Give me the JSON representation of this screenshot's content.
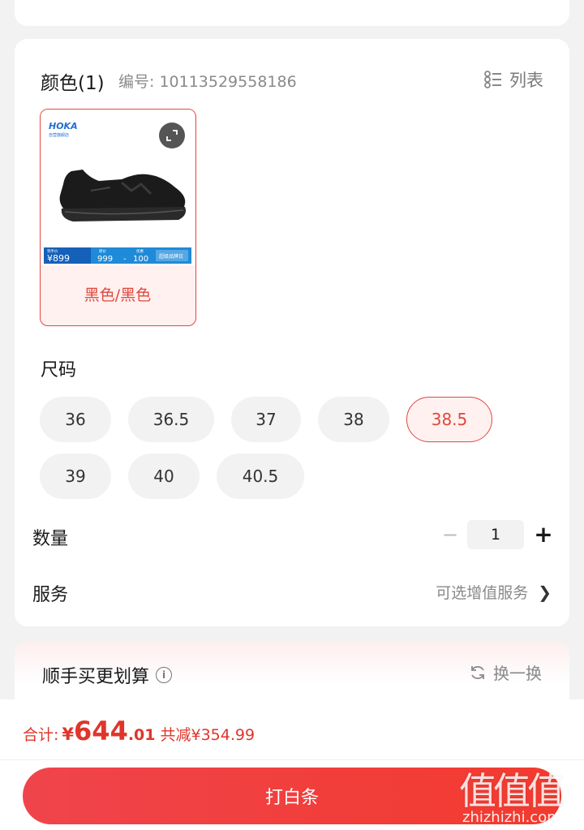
{
  "spec": {
    "color_title": "颜色(1)",
    "sku_label": "编号: 10113529558186",
    "list_label": "列表",
    "color_options": [
      {
        "name": "黑色/黑色",
        "brand_logo": "HOKA",
        "brand_sub": "自营旗舰店",
        "promo": {
          "tag": "到手价",
          "price": "¥899",
          "orig_label": "原价",
          "orig_value": "999",
          "coupon_label": "优惠",
          "coupon_value": "100",
          "event": "超级品牌日"
        }
      }
    ],
    "size_title": "尺码",
    "sizes": [
      "36",
      "36.5",
      "37",
      "38",
      "38.5",
      "39",
      "40",
      "40.5"
    ],
    "selected_size": "38.5",
    "quantity_label": "数量",
    "quantity_minus": "−",
    "quantity_value": "1",
    "quantity_plus": "+",
    "service_label": "服务",
    "service_value": "可选增值服务",
    "service_chevron": "❯"
  },
  "bundle": {
    "title": "顺手买更划算",
    "info_icon": "i",
    "refresh_label": "换一换"
  },
  "footer": {
    "total_label": "合计:",
    "total_currency": "¥",
    "total_integer": "644",
    "total_decimal": ".01",
    "saved_text": "共减¥354.99",
    "pay_button": "打白条"
  },
  "watermark": {
    "glyphs": "值值值",
    "site": "zhizhizhi.com"
  },
  "colors": {
    "accent": "#e4473f",
    "price_red": "#e0352b",
    "button_red": "#f23a2e"
  }
}
